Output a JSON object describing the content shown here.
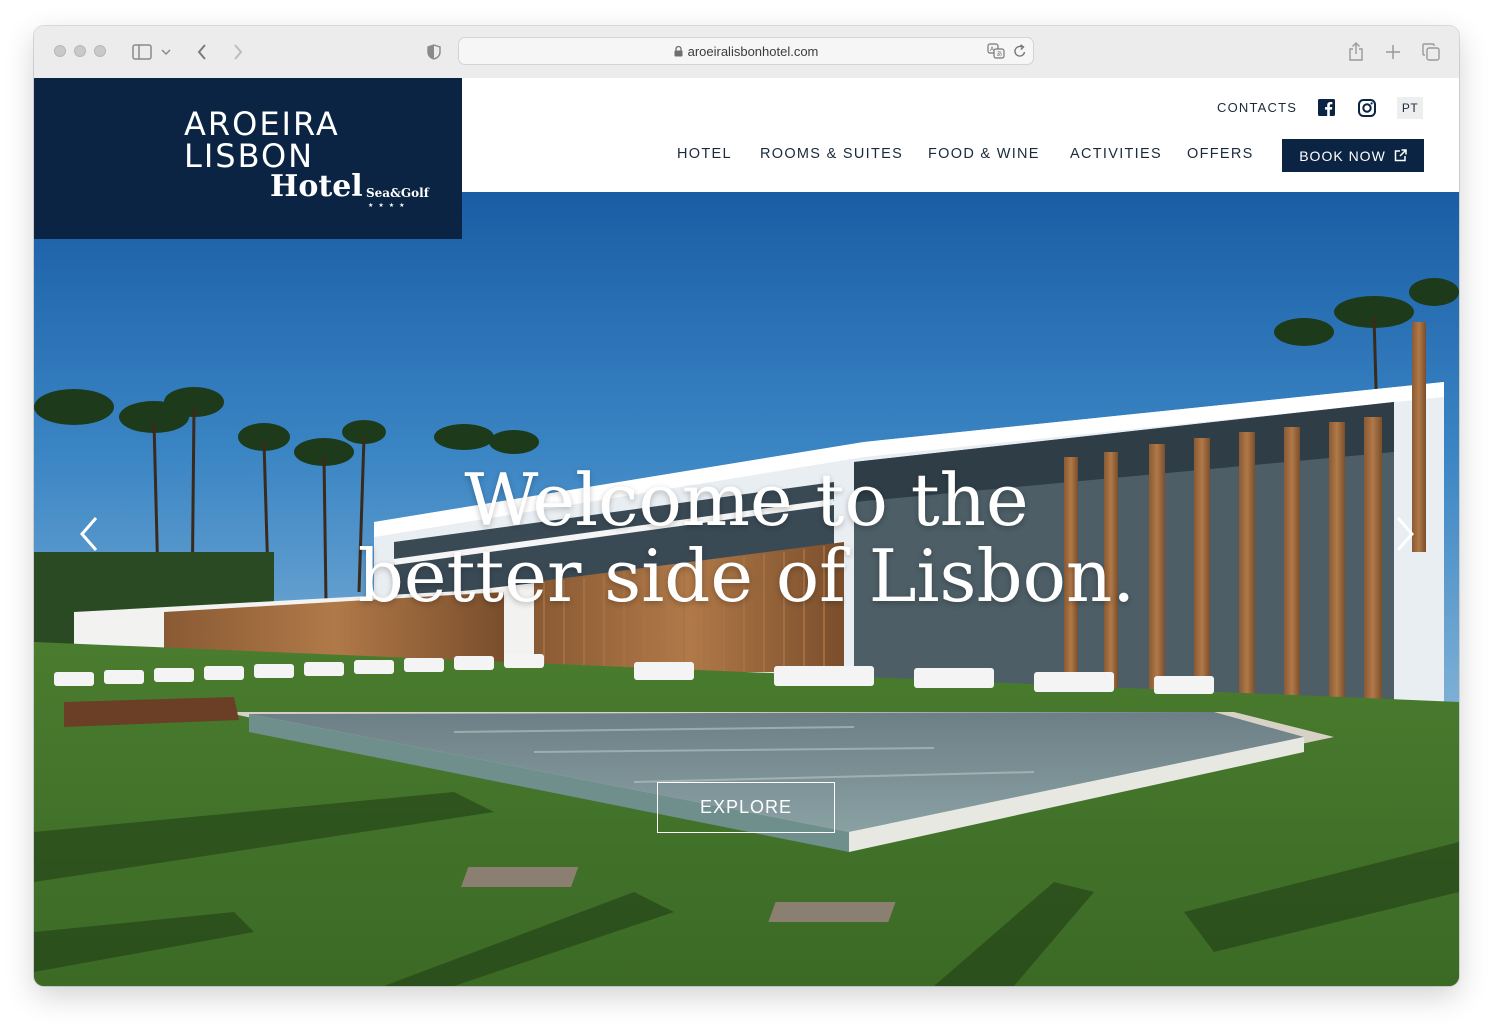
{
  "browser": {
    "url": "aroeiralisbonhotel.com",
    "icons": [
      "sidebar-icon",
      "chevron-down-icon",
      "back-icon",
      "forward-icon",
      "shield-icon",
      "lock-icon",
      "translate-icon",
      "reload-icon",
      "share-icon",
      "new-tab-icon",
      "tabs-overview-icon"
    ]
  },
  "header": {
    "logo": {
      "line1": "AROEIRA",
      "line2": "LISBON",
      "hotel": "Hotel",
      "tagline": "Sea&Golf",
      "stars": "★★★★"
    },
    "top_links": {
      "contacts": "CONTACTS",
      "language": "PT"
    },
    "nav": [
      {
        "label": "HOTEL"
      },
      {
        "label": "ROOMS & SUITES"
      },
      {
        "label": "FOOD & WINE"
      },
      {
        "label": "ACTIVITIES"
      },
      {
        "label": "OFFERS"
      }
    ],
    "book_now": "BOOK NOW"
  },
  "hero": {
    "title_line1": "Welcome to the",
    "title_line2": "better side of Lisbon.",
    "cta": "EXPLORE"
  },
  "colors": {
    "navy": "#0b2444",
    "messenger": "#1877f2"
  }
}
